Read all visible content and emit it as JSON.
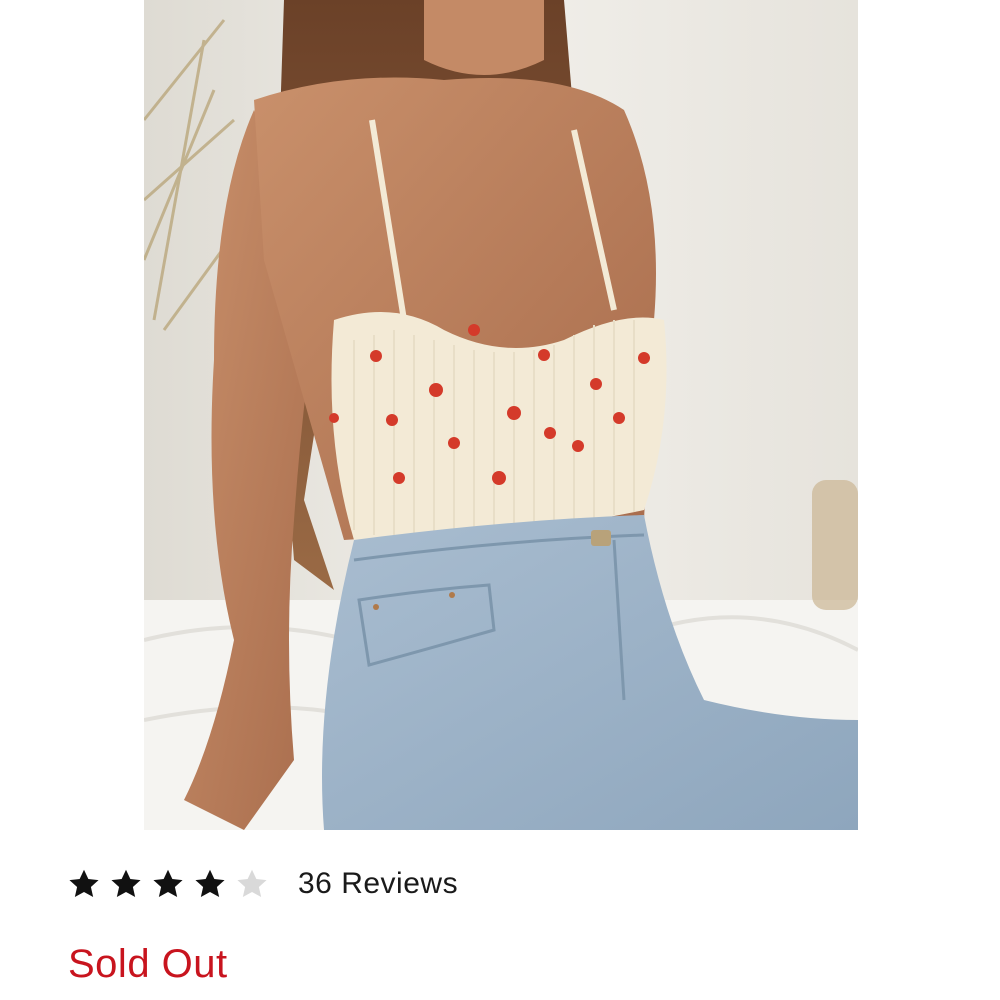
{
  "product": {
    "image_alt": "Model wearing cream ribbed cropped cami with red fruit embroidery and light wash jeans"
  },
  "rating": {
    "value": 4,
    "max": 5,
    "filled_color": "#111111",
    "empty_color": "#d9d9d9"
  },
  "reviews": {
    "label": "36 Reviews"
  },
  "stock": {
    "label": "Sold Out",
    "color": "#c8141e"
  }
}
